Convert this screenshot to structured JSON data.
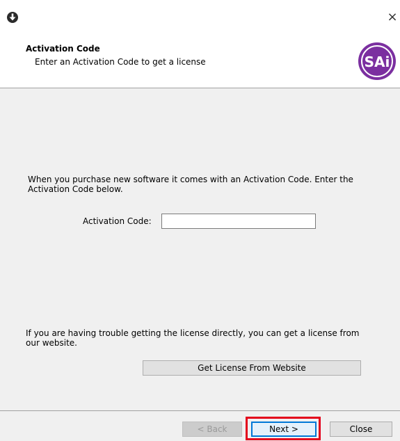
{
  "window": {
    "close_glyph": "×"
  },
  "header": {
    "title": "Activation Code",
    "subtitle": "Enter an Activation Code to get a license",
    "logo_text": "SAi",
    "logo_color": "#7b2fa0"
  },
  "main": {
    "intro_text": "When you purchase new software it comes with an Activation Code. Enter the\nActivation Code below.",
    "activation_label": "Activation Code:",
    "activation_value": "",
    "trouble_text": "If you are having trouble getting the license directly, you can get a license from\nour website.",
    "website_button": "Get License From Website"
  },
  "footer": {
    "back_button": "< Back",
    "next_button": "Next >",
    "close_button": "Close"
  },
  "annotation": {
    "highlight_color": "#e3001b"
  }
}
